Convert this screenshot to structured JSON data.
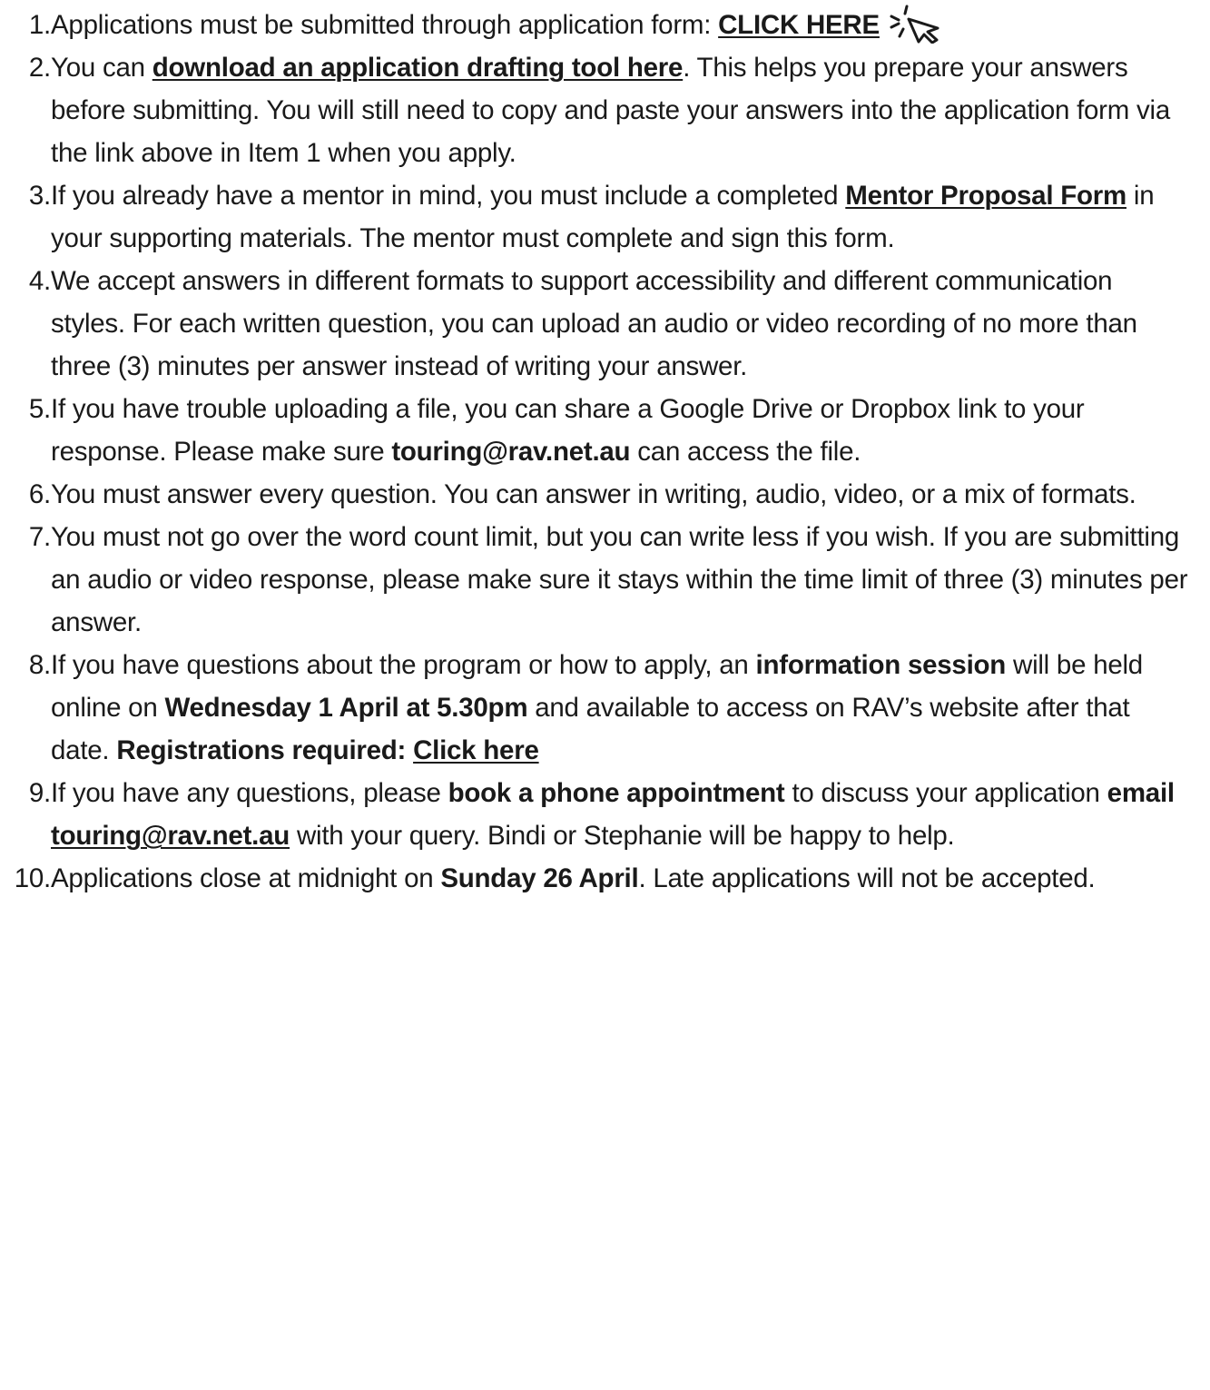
{
  "items": [
    {
      "num": "1.",
      "t1": "Applications must be submitted through application form: ",
      "link": "CLICK HERE",
      "icon": "cursor-click-icon"
    },
    {
      "num": "2.",
      "t1": "You can ",
      "link": "download an application drafting tool here",
      "t2": ". This helps you prepare your answers before submitting. You will still need to copy and paste your answers into the application form  via the link above in Item 1 when you apply."
    },
    {
      "num": "3.",
      "t1": "If you already have a mentor in mind, you must include a completed ",
      "link": "Mentor Proposal Form",
      "t2": " in your supporting materials. The mentor must complete and sign this form."
    },
    {
      "num": "4.",
      "t1": "We accept answers in different formats to support accessibility and different communication styles. For each written question, you can upload an audio or video recording of no more than three (3) minutes per answer instead of writing your answer."
    },
    {
      "num": "5.",
      "t1": "If you have trouble uploading a file, you can share a Google Drive or Dropbox link to your response. Please make sure ",
      "bold": "touring@rav.net.au",
      "t2": " can access the file."
    },
    {
      "num": "6.",
      "t1": "You must answer every question. You can answer in writing, audio, video, or a mix of formats."
    },
    {
      "num": "7.",
      "t1": "You must not go over the word count limit, but you can write less if you wish. If you are submitting an audio or video response, please make sure it stays within the time limit of three (3) minutes per answer."
    },
    {
      "num": "8.",
      "t1": "If you have questions about the program or how to apply, an ",
      "bold1": "information session",
      "t2": " will be held online on ",
      "bold2": "Wednesday 1 April at 5.30pm",
      "t3": " and available to access on RAV’s website after that date.  ",
      "bold3": "Registrations required: ",
      "link": "Click here"
    },
    {
      "num": "9.",
      "t1": "If you have any questions, please ",
      "bold1": "book a phone appointment",
      "t2": " to discuss your application ",
      "bold2": "email ",
      "link": "touring@rav.net.au",
      "t3": " with your query.  Bindi or Stephanie will be happy to help."
    },
    {
      "num": "10.",
      "t1": "Applications close at midnight on ",
      "bold": "Sunday 26 April",
      "t2": ". Late applications will not be accepted."
    }
  ]
}
